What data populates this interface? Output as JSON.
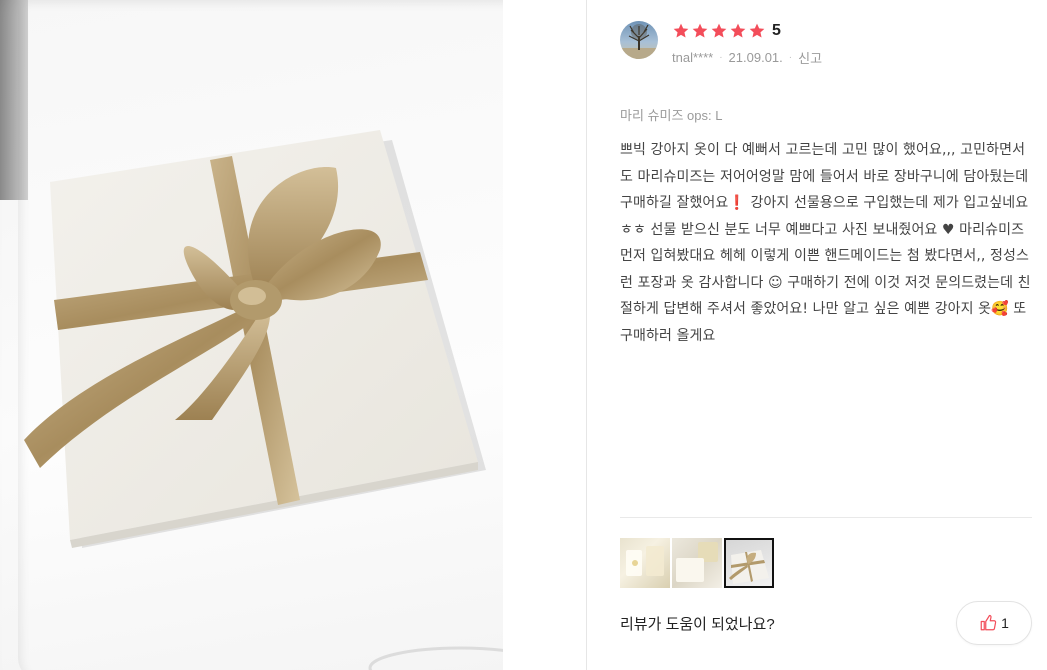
{
  "review": {
    "rating": "5",
    "star_count": 5,
    "star_color": "#f34d5a",
    "reviewer": "tnal****",
    "date": "21.09.01.",
    "report_label": "신고",
    "option": "마리 슈미즈 ops: L",
    "body": "쁘빅 강아지 옷이 다 예뻐서 고르는데 고민 많이 했어요,,, 고민하면서도 마리슈미즈는 저어어엉말 맘에 들어서 바로 장바구니에 담아뒀는데 구매하길 잘했어요❗ 강아지 선물용으로 구입했는데 제가 입고싶네요 ㅎㅎ 선물 받으신 분도 너무 예쁘다고 사진 보내줬어요 ♥ 마리슈미즈 먼저 입혀봤대요 헤헤 이렇게 이쁜 핸드메이드는 첨 봤다면서,, 정성스런 포장과 옷 감사합니다 ☺ 구매하기 전에 이것 저것 문의드렸는데 친절하게 답변해 주셔서 좋았어요! 나만 알고 싶은 예쁜 강아지 옷🥰 또 구매하러 올게요"
  },
  "thumbnails": [
    {
      "name": "thumbnail-1",
      "active": false
    },
    {
      "name": "thumbnail-2",
      "active": false
    },
    {
      "name": "thumbnail-3",
      "active": true
    }
  ],
  "footer": {
    "helpful_question": "리뷰가 도움이 되었나요?",
    "like_count": "1",
    "like_icon": "thumbs-up-icon",
    "like_icon_color": "#f34d5a"
  }
}
